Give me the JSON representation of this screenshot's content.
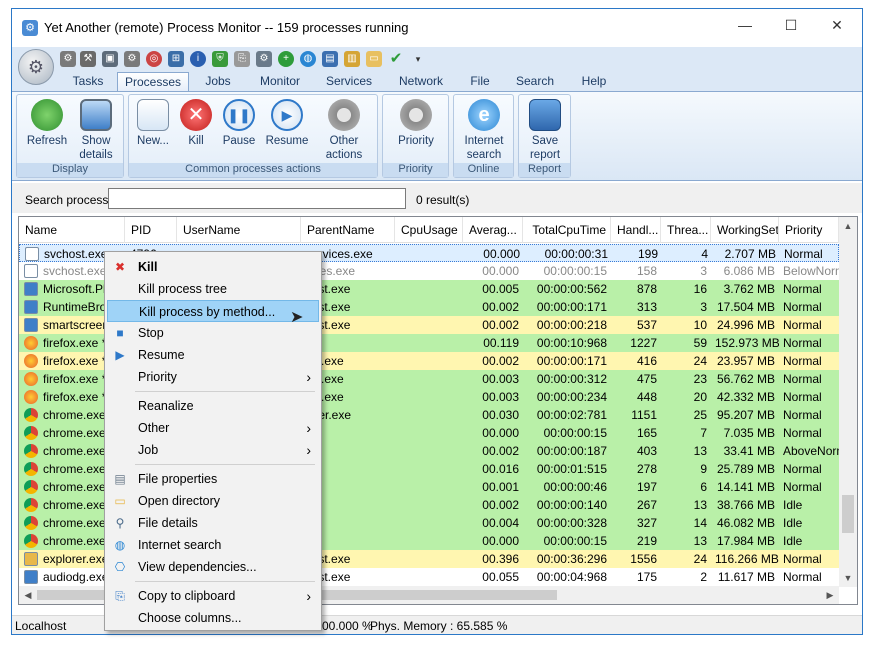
{
  "window": {
    "title": "Yet Another (remote) Process Monitor -- 159 processes running",
    "controls": {
      "minimize": "—",
      "maximize": "☐",
      "close": "✕"
    }
  },
  "tabs": [
    "Tasks",
    "Processes",
    "Jobs",
    "Monitor",
    "Services",
    "Network",
    "File",
    "Search",
    "Help"
  ],
  "ribbon": {
    "groups": [
      {
        "label": "Display"
      },
      {
        "label": "Common processes actions"
      },
      {
        "label": "Priority"
      },
      {
        "label": "Online"
      },
      {
        "label": "Report"
      }
    ],
    "buttons": [
      {
        "label": "Refresh",
        "color": "#3aa845"
      },
      {
        "label": "Show details",
        "color": "#4a8bd4"
      },
      {
        "label": "New...",
        "color": "#5fb85f"
      },
      {
        "label": "Kill",
        "color": "#d9302c"
      },
      {
        "label": "Pause",
        "color": "#2f79c9"
      },
      {
        "label": "Resume",
        "color": "#2f79c9"
      },
      {
        "label": "Other actions",
        "color": "#8a8a8a"
      },
      {
        "label": "Priority",
        "color": "#8a8a8a"
      },
      {
        "label": "Internet search",
        "color": "#2a86d3"
      },
      {
        "label": "Save report",
        "color": "#3c7fc0"
      }
    ]
  },
  "search": {
    "label": "Search process",
    "value": "",
    "result": "0 result(s)"
  },
  "columns": [
    "Name",
    "PID",
    "UserName",
    "ParentName",
    "CpuUsage",
    "Averag...",
    "TotalCpuTime",
    "Handl...",
    "Threa...",
    "WorkingSet",
    "Priority"
  ],
  "rows": [
    {
      "name": "svchost.exe",
      "pid": "4796",
      "parent": "services.exe",
      "avg": "00.000",
      "total": "00:00:00:31",
      "handles": "199",
      "threads": "4",
      "ws": "2.707 MB",
      "priority": "Normal",
      "bg": "#ddeeff",
      "fg": "#000"
    },
    {
      "name": "svchost.exe",
      "pid": "",
      "parent": "vices.exe",
      "avg": "00.000",
      "total": "00:00:00:15",
      "handles": "158",
      "threads": "3",
      "ws": "6.086 MB",
      "priority": "BelowNorm",
      "bg": "#ffffff",
      "fg": "#888"
    },
    {
      "name": "Microsoft.Ph",
      "pid": "",
      "parent": "host.exe",
      "avg": "00.005",
      "total": "00:00:00:562",
      "handles": "878",
      "threads": "16",
      "ws": "3.762 MB",
      "priority": "Normal",
      "bg": "#b9f0a8",
      "fg": "#000"
    },
    {
      "name": "RuntimeBrol",
      "pid": "",
      "parent": "host.exe",
      "avg": "00.002",
      "total": "00:00:00:171",
      "handles": "313",
      "threads": "3",
      "ws": "17.504 MB",
      "priority": "Normal",
      "bg": "#b9f0a8",
      "fg": "#000"
    },
    {
      "name": "smartscreen",
      "pid": "",
      "parent": "host.exe",
      "avg": "00.002",
      "total": "00:00:00:218",
      "handles": "537",
      "threads": "10",
      "ws": "24.996 MB",
      "priority": "Normal",
      "bg": "#fff6b0",
      "fg": "#000"
    },
    {
      "name": "firefox.exe *",
      "pid": "",
      "parent": "",
      "avg": "00.119",
      "total": "00:00:10:968",
      "handles": "1227",
      "threads": "59",
      "ws": "152.973 MB",
      "priority": "Normal",
      "bg": "#b9f0a8",
      "fg": "#000"
    },
    {
      "name": "firefox.exe *",
      "pid": "",
      "parent": "fox.exe",
      "avg": "00.002",
      "total": "00:00:00:171",
      "handles": "416",
      "threads": "24",
      "ws": "23.957 MB",
      "priority": "Normal",
      "bg": "#fff6b0",
      "fg": "#000"
    },
    {
      "name": "firefox.exe *",
      "pid": "",
      "parent": "fox.exe",
      "avg": "00.003",
      "total": "00:00:00:312",
      "handles": "475",
      "threads": "23",
      "ws": "56.762 MB",
      "priority": "Normal",
      "bg": "#b9f0a8",
      "fg": "#000"
    },
    {
      "name": "firefox.exe *",
      "pid": "",
      "parent": "fox.exe",
      "avg": "00.003",
      "total": "00:00:00:234",
      "handles": "448",
      "threads": "20",
      "ws": "42.332 MB",
      "priority": "Normal",
      "bg": "#b9f0a8",
      "fg": "#000"
    },
    {
      "name": "chrome.exe",
      "pid": "",
      "parent": "lorer.exe",
      "avg": "00.030",
      "total": "00:00:02:781",
      "handles": "1151",
      "threads": "25",
      "ws": "95.207 MB",
      "priority": "Normal",
      "bg": "#b9f0a8",
      "fg": "#000"
    },
    {
      "name": "chrome.exe",
      "pid": "",
      "parent": "",
      "avg": "00.000",
      "total": "00:00:00:15",
      "handles": "165",
      "threads": "7",
      "ws": "7.035 MB",
      "priority": "Normal",
      "bg": "#b9f0a8",
      "fg": "#000"
    },
    {
      "name": "chrome.exe",
      "pid": "",
      "parent": "",
      "avg": "00.002",
      "total": "00:00:00:187",
      "handles": "403",
      "threads": "13",
      "ws": "33.41 MB",
      "priority": "AboveNorm",
      "bg": "#b9f0a8",
      "fg": "#000"
    },
    {
      "name": "chrome.exe",
      "pid": "",
      "parent": "",
      "avg": "00.016",
      "total": "00:00:01:515",
      "handles": "278",
      "threads": "9",
      "ws": "25.789 MB",
      "priority": "Normal",
      "bg": "#b9f0a8",
      "fg": "#000"
    },
    {
      "name": "chrome.exe",
      "pid": "",
      "parent": "",
      "avg": "00.001",
      "total": "00:00:00:46",
      "handles": "197",
      "threads": "6",
      "ws": "14.141 MB",
      "priority": "Normal",
      "bg": "#b9f0a8",
      "fg": "#000"
    },
    {
      "name": "chrome.exe",
      "pid": "",
      "parent": "",
      "avg": "00.002",
      "total": "00:00:00:140",
      "handles": "267",
      "threads": "13",
      "ws": "38.766 MB",
      "priority": "Idle",
      "bg": "#b9f0a8",
      "fg": "#000"
    },
    {
      "name": "chrome.exe",
      "pid": "",
      "parent": "",
      "avg": "00.004",
      "total": "00:00:00:328",
      "handles": "327",
      "threads": "14",
      "ws": "46.082 MB",
      "priority": "Idle",
      "bg": "#b9f0a8",
      "fg": "#000"
    },
    {
      "name": "chrome.exe",
      "pid": "",
      "parent": "",
      "avg": "00.000",
      "total": "00:00:00:15",
      "handles": "219",
      "threads": "13",
      "ws": "17.984 MB",
      "priority": "Idle",
      "bg": "#b9f0a8",
      "fg": "#000"
    },
    {
      "name": "explorer.exe",
      "pid": "",
      "parent": "host.exe",
      "avg": "00.396",
      "total": "00:00:36:296",
      "handles": "1556",
      "threads": "24",
      "ws": "116.266 MB",
      "priority": "Normal",
      "bg": "#fff6b0",
      "fg": "#000"
    },
    {
      "name": "audiodg.exe",
      "pid": "",
      "parent": "host.exe",
      "avg": "00.055",
      "total": "00:00:04:968",
      "handles": "175",
      "threads": "2",
      "ws": "11.617 MB",
      "priority": "Normal",
      "bg": "#ffffff",
      "fg": "#000"
    }
  ],
  "context_menu": [
    {
      "label": "Kill",
      "icon": "kill",
      "bold": true
    },
    {
      "label": "Kill process tree"
    },
    {
      "label": "Kill process by method...",
      "highlight": true
    },
    {
      "label": "Stop",
      "icon": "stop"
    },
    {
      "label": "Resume",
      "icon": "resume"
    },
    {
      "label": "Priority",
      "submenu": true
    },
    {
      "separator": true
    },
    {
      "label": "Reanalize"
    },
    {
      "label": "Other",
      "submenu": true
    },
    {
      "label": "Job",
      "submenu": true
    },
    {
      "separator": true
    },
    {
      "label": "File properties",
      "icon": "file"
    },
    {
      "label": "Open directory",
      "icon": "folder"
    },
    {
      "label": "File details",
      "icon": "magnifier"
    },
    {
      "label": "Internet search",
      "icon": "globe"
    },
    {
      "label": "View dependencies...",
      "icon": "deps"
    },
    {
      "separator": true
    },
    {
      "label": "Copy to clipboard",
      "icon": "copy",
      "submenu": true
    },
    {
      "label": "Choose columns..."
    }
  ],
  "status": {
    "host": "Localhost",
    "cpu": "00.000 %",
    "memory": "Phys. Memory : 65.585 %"
  }
}
